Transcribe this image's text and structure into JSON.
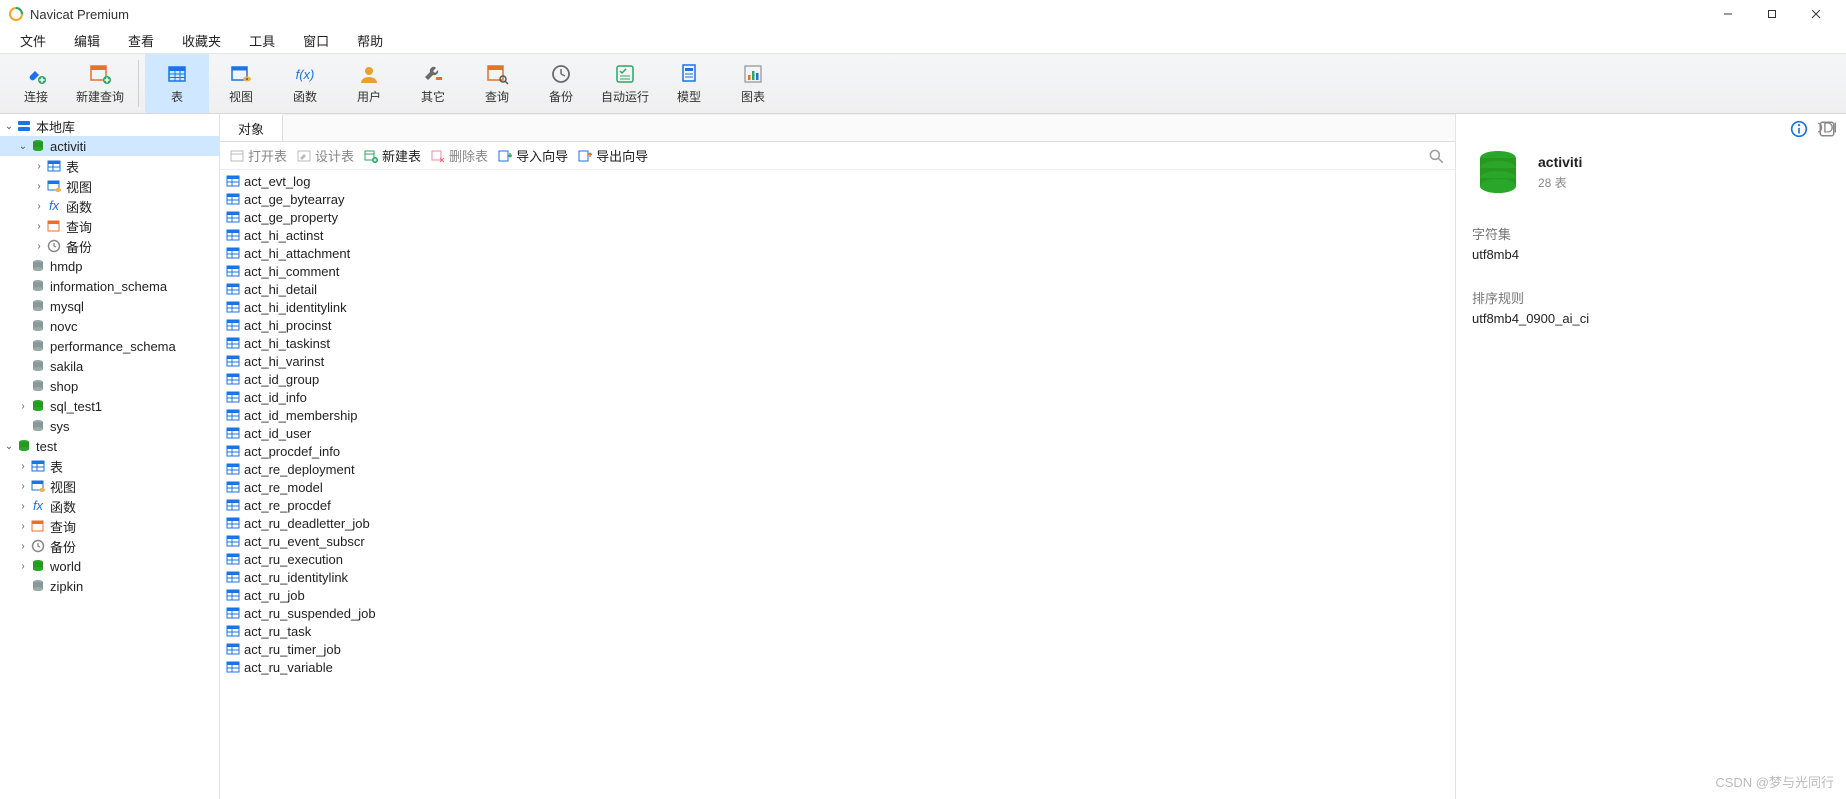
{
  "title": "Navicat Premium",
  "menu": [
    "文件",
    "编辑",
    "查看",
    "收藏夹",
    "工具",
    "窗口",
    "帮助"
  ],
  "toolbar": [
    {
      "key": "connect",
      "label": "连接",
      "icon": "plug",
      "accent": "#1a73e8"
    },
    {
      "key": "newquery",
      "label": "新建查询",
      "icon": "grid-plus",
      "accent": "#e8712a"
    },
    {
      "sep": true
    },
    {
      "key": "table",
      "label": "表",
      "icon": "grid",
      "accent": "#1a73e8",
      "active": true
    },
    {
      "key": "view",
      "label": "视图",
      "icon": "grid-eye",
      "accent": "#1a73e8"
    },
    {
      "key": "function",
      "label": "函数",
      "icon": "fx",
      "accent": "#1a73e8"
    },
    {
      "key": "user",
      "label": "用户",
      "icon": "user",
      "accent": "#e8a12a"
    },
    {
      "key": "other",
      "label": "其它",
      "icon": "wrench",
      "accent": "#6b6b6b"
    },
    {
      "key": "query",
      "label": "查询",
      "icon": "grid-search",
      "accent": "#e8712a"
    },
    {
      "key": "backup",
      "label": "备份",
      "icon": "clock",
      "accent": "#6b6b6b"
    },
    {
      "key": "autorun",
      "label": "自动运行",
      "icon": "list-check",
      "accent": "#2aa766"
    },
    {
      "key": "model",
      "label": "模型",
      "icon": "doc",
      "accent": "#1a73e8"
    },
    {
      "key": "chart",
      "label": "图表",
      "icon": "chart",
      "accent": "#e8712a"
    }
  ],
  "tree": [
    {
      "d": 0,
      "tw": "open",
      "icon": "server-blue",
      "label": "本地库"
    },
    {
      "d": 1,
      "tw": "open",
      "icon": "db-green",
      "label": "activiti",
      "selected": true
    },
    {
      "d": 2,
      "tw": "closed",
      "icon": "grid-blue",
      "label": "表"
    },
    {
      "d": 2,
      "tw": "closed",
      "icon": "view-blue",
      "label": "视图"
    },
    {
      "d": 2,
      "tw": "closed",
      "icon": "fx-blue",
      "label": "函数"
    },
    {
      "d": 2,
      "tw": "closed",
      "icon": "query-orange",
      "label": "查询"
    },
    {
      "d": 2,
      "tw": "closed",
      "icon": "backup-grey",
      "label": "备份"
    },
    {
      "d": 1,
      "tw": "none",
      "icon": "db-grey",
      "label": "hmdp"
    },
    {
      "d": 1,
      "tw": "none",
      "icon": "db-grey",
      "label": "information_schema"
    },
    {
      "d": 1,
      "tw": "none",
      "icon": "db-grey",
      "label": "mysql"
    },
    {
      "d": 1,
      "tw": "none",
      "icon": "db-grey",
      "label": "novc"
    },
    {
      "d": 1,
      "tw": "none",
      "icon": "db-grey",
      "label": "performance_schema"
    },
    {
      "d": 1,
      "tw": "none",
      "icon": "db-grey",
      "label": "sakila"
    },
    {
      "d": 1,
      "tw": "none",
      "icon": "db-grey",
      "label": "shop"
    },
    {
      "d": 1,
      "tw": "closed",
      "icon": "db-green",
      "label": "sql_test1"
    },
    {
      "d": 1,
      "tw": "none",
      "icon": "db-grey",
      "label": "sys"
    },
    {
      "d": 0,
      "tw": "open",
      "icon": "db-green",
      "label": "test"
    },
    {
      "d": 1,
      "tw": "closed",
      "icon": "grid-blue",
      "label": "表"
    },
    {
      "d": 1,
      "tw": "closed",
      "icon": "view-blue",
      "label": "视图"
    },
    {
      "d": 1,
      "tw": "closed",
      "icon": "fx-blue",
      "label": "函数"
    },
    {
      "d": 1,
      "tw": "closed",
      "icon": "query-orange",
      "label": "查询"
    },
    {
      "d": 1,
      "tw": "closed",
      "icon": "backup-grey",
      "label": "备份"
    },
    {
      "d": 1,
      "tw": "closed",
      "icon": "db-green",
      "label": "world"
    },
    {
      "d": 1,
      "tw": "none",
      "icon": "db-grey",
      "label": "zipkin"
    }
  ],
  "centerTab": "对象",
  "objbar": {
    "open": "打开表",
    "design": "设计表",
    "new": "新建表",
    "delete": "删除表",
    "import": "导入向导",
    "export": "导出向导"
  },
  "tables": [
    "act_evt_log",
    "act_ge_bytearray",
    "act_ge_property",
    "act_hi_actinst",
    "act_hi_attachment",
    "act_hi_comment",
    "act_hi_detail",
    "act_hi_identitylink",
    "act_hi_procinst",
    "act_hi_taskinst",
    "act_hi_varinst",
    "act_id_group",
    "act_id_info",
    "act_id_membership",
    "act_id_user",
    "act_procdef_info",
    "act_re_deployment",
    "act_re_model",
    "act_re_procdef",
    "act_ru_deadletter_job",
    "act_ru_event_subscr",
    "act_ru_execution",
    "act_ru_identitylink",
    "act_ru_job",
    "act_ru_suspended_job",
    "act_ru_task",
    "act_ru_timer_job",
    "act_ru_variable"
  ],
  "right": {
    "name": "activiti",
    "countLabel": "28 表",
    "charsetLabel": "字符集",
    "charsetValue": "utf8mb4",
    "collationLabel": "排序规则",
    "collationValue": "utf8mb4_0900_ai_ci"
  },
  "watermark": "CSDN @梦与光同行"
}
